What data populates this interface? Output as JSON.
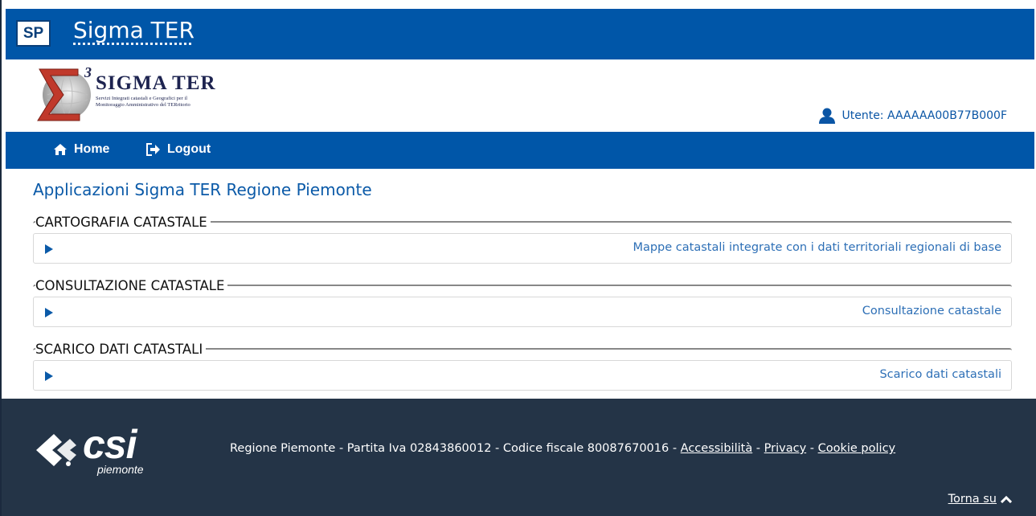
{
  "header": {
    "logo_text": "SP",
    "title": "Sigma TER"
  },
  "brand": {
    "name": "SIGMA TER",
    "tagline_line1": "Servizi Integrati catastali e Geografici per il",
    "tagline_line2": "Monitoraggio Amministrativo del TERritorio",
    "mark": "3"
  },
  "user": {
    "label": "Utente: AAAAAA00B77B000F",
    "icon": "user-icon"
  },
  "nav": {
    "home_label": "Home",
    "logout_label": "Logout"
  },
  "page": {
    "title": "Applicazioni Sigma TER Regione Piemonte"
  },
  "sections": [
    {
      "title": "CARTOGRAFIA CATASTALE",
      "link": "Mappe catastali integrate con i dati territoriali regionali di base"
    },
    {
      "title": "CONSULTAZIONE CATASTALE",
      "link": "Consultazione catastale"
    },
    {
      "title": "SCARICO DATI CATASTALI",
      "link": "Scarico dati catastali"
    }
  ],
  "footer": {
    "logo_text": "csi",
    "logo_sub": "piemonte",
    "info": "Regione Piemonte - Partita Iva 02843860012 - Codice fiscale 80087670016 - ",
    "accessibility": "Accessibilità",
    "sep1": " - ",
    "privacy": "Privacy",
    "sep2": " - ",
    "cookie": "Cookie policy",
    "back_to_top": "Torna su"
  },
  "colors": {
    "primary_blue": "#0056a8",
    "footer_bg": "#243447",
    "link_blue": "#2d6fb6"
  }
}
